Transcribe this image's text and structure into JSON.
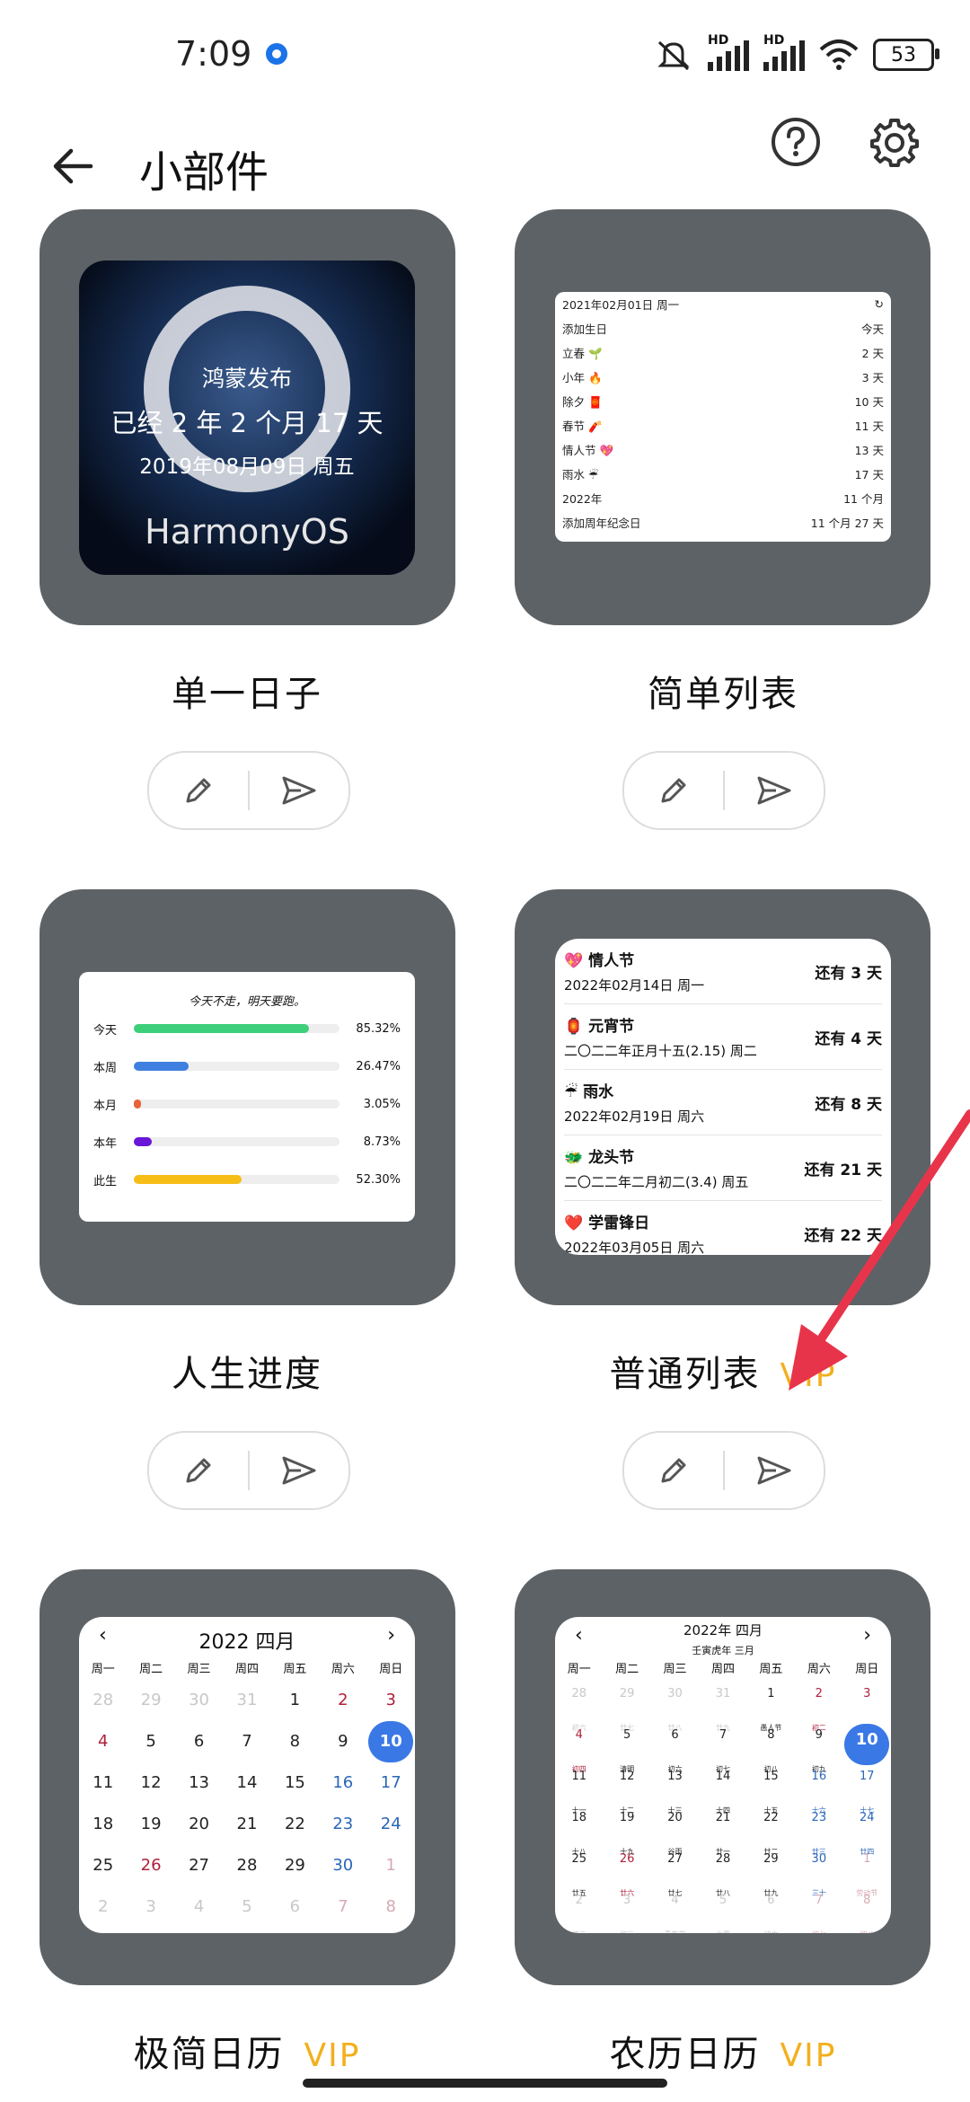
{
  "status": {
    "time": "7:09",
    "battery": "53",
    "hd": "HD"
  },
  "header": {
    "title": "小部件"
  },
  "cards": [
    {
      "label": "单一日子",
      "vip": ""
    },
    {
      "label": "简单列表",
      "vip": ""
    },
    {
      "label": "人生进度",
      "vip": ""
    },
    {
      "label": "普通列表",
      "vip": "VIP"
    },
    {
      "label": "极简日历",
      "vip": "VIP"
    },
    {
      "label": "农历日历",
      "vip": "VIP"
    }
  ],
  "w1": {
    "title": "鸿蒙发布",
    "elapsed": "已经 2 年 2 个月 17 天",
    "date": "2019年08月09日 周五",
    "logo": "HarmonyOS"
  },
  "w2": {
    "header_date": "2021年02月01日 周一",
    "rows": [
      {
        "name": "添加生日",
        "value": "今天"
      },
      {
        "name": "立春 🌱",
        "value": "2 天"
      },
      {
        "name": "小年 🔥",
        "value": "3 天"
      },
      {
        "name": "除夕 🧧",
        "value": "10 天"
      },
      {
        "name": "春节 🧨",
        "value": "11 天"
      },
      {
        "name": "情人节 💖",
        "value": "13 天"
      },
      {
        "name": "雨水 ☔",
        "value": "17 天"
      },
      {
        "name": "2022年",
        "value": "11 个月"
      },
      {
        "name": "添加周年纪念日",
        "value": "11 个月 27 天"
      }
    ]
  },
  "w3": {
    "quote": "今天不走，明天要跑。",
    "rows": [
      {
        "label": "今天",
        "value": "85.32%",
        "fraction": 0.8532,
        "color": "#3ecf7a"
      },
      {
        "label": "本周",
        "value": "26.47%",
        "fraction": 0.2647,
        "color": "#3f7fe0"
      },
      {
        "label": "本月",
        "value": "3.05%",
        "fraction": 0.0305,
        "color": "#e8623a"
      },
      {
        "label": "本年",
        "value": "8.73%",
        "fraction": 0.0873,
        "color": "#6a16d6"
      },
      {
        "label": "此生",
        "value": "52.30%",
        "fraction": 0.523,
        "color": "#f6bd16"
      }
    ]
  },
  "w4": {
    "items": [
      {
        "icon": "💖",
        "name": "情人节",
        "date": "2022年02月14日 周一",
        "remain": "还有 3 天"
      },
      {
        "icon": "🏮",
        "name": "元宵节",
        "date": "二〇二二年正月十五(2.15) 周二",
        "remain": "还有 4 天"
      },
      {
        "icon": "☔",
        "name": "雨水",
        "date": "2022年02月19日 周六",
        "remain": "还有 8 天"
      },
      {
        "icon": "🐲",
        "name": "龙头节",
        "date": "二〇二二年二月初二(3.4) 周五",
        "remain": "还有 21 天"
      },
      {
        "icon": "❤️",
        "name": "学雷锋日",
        "date": "2022年03月05日 周六",
        "remain": "还有 22 天"
      }
    ]
  },
  "cal1": {
    "title": "2022 四月",
    "prev": "‹",
    "next": "›",
    "weekdays": [
      "周一",
      "周二",
      "周三",
      "周四",
      "周五",
      "周六",
      "周日"
    ],
    "days": [
      "28",
      "29",
      "30",
      "31",
      "1",
      "2",
      "3",
      "4",
      "5",
      "6",
      "7",
      "8",
      "9",
      "10",
      "11",
      "12",
      "13",
      "14",
      "15",
      "16",
      "17",
      "18",
      "19",
      "20",
      "21",
      "22",
      "23",
      "24",
      "25",
      "26",
      "27",
      "28",
      "29",
      "30",
      "1",
      "2",
      "3",
      "4",
      "5",
      "6",
      "7",
      "8"
    ]
  },
  "cal2": {
    "title": "2022年 四月",
    "subtitle": "壬寅虎年 三月",
    "prev": "‹",
    "next": "›",
    "weekdays": [
      "周一",
      "周二",
      "周三",
      "周四",
      "周五",
      "周六",
      "周日"
    ],
    "days": [
      {
        "d": "28",
        "l": "初六"
      },
      {
        "d": "29",
        "l": "廿七"
      },
      {
        "d": "30",
        "l": "廿八"
      },
      {
        "d": "31",
        "l": "廿九"
      },
      {
        "d": "1",
        "l": "愚人节"
      },
      {
        "d": "2",
        "l": "初二"
      },
      {
        "d": "3",
        "l": "初三"
      },
      {
        "d": "4",
        "l": "初四"
      },
      {
        "d": "5",
        "l": "清明"
      },
      {
        "d": "6",
        "l": "初六"
      },
      {
        "d": "7",
        "l": "初七"
      },
      {
        "d": "8",
        "l": "初八"
      },
      {
        "d": "9",
        "l": "初九"
      },
      {
        "d": "10",
        "l": "初十"
      },
      {
        "d": "11",
        "l": "十一"
      },
      {
        "d": "12",
        "l": "十二"
      },
      {
        "d": "13",
        "l": "十三"
      },
      {
        "d": "14",
        "l": "十四"
      },
      {
        "d": "15",
        "l": "十五"
      },
      {
        "d": "16",
        "l": "十六"
      },
      {
        "d": "17",
        "l": "十七"
      },
      {
        "d": "18",
        "l": "十八"
      },
      {
        "d": "19",
        "l": "十九"
      },
      {
        "d": "20",
        "l": "谷雨"
      },
      {
        "d": "21",
        "l": "廿一"
      },
      {
        "d": "22",
        "l": "廿二"
      },
      {
        "d": "23",
        "l": "廿三"
      },
      {
        "d": "24",
        "l": "廿四"
      },
      {
        "d": "25",
        "l": "廿五"
      },
      {
        "d": "26",
        "l": "廿六"
      },
      {
        "d": "27",
        "l": "廿七"
      },
      {
        "d": "28",
        "l": "廿八"
      },
      {
        "d": "29",
        "l": "廿九"
      },
      {
        "d": "30",
        "l": "三十"
      },
      {
        "d": "1",
        "l": "劳动节"
      },
      {
        "d": "2",
        "l": "初二"
      },
      {
        "d": "3",
        "l": "初三"
      },
      {
        "d": "4",
        "l": "青年节"
      },
      {
        "d": "5",
        "l": "立夏"
      },
      {
        "d": "6",
        "l": "初六"
      },
      {
        "d": "7",
        "l": "初七"
      },
      {
        "d": "8",
        "l": "初八"
      }
    ]
  },
  "colors": {
    "card_bg": "#5d6266",
    "accent": "#3a78e6",
    "vip": "#f2b01e",
    "weekend_red": "#b0203a",
    "weekend_blue": "#2a66b8",
    "annotation_arrow": "#e8344a"
  }
}
